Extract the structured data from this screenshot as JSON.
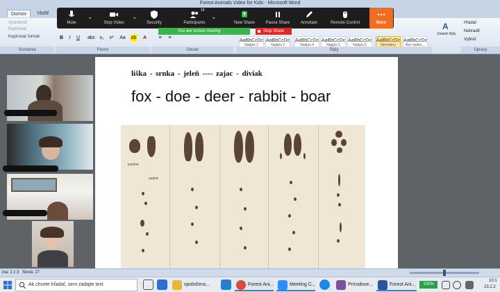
{
  "word": {
    "title": "Forest Animals Video for Kids - Microsoft Word",
    "tabs": [
      {
        "label": "Domov",
        "active": true
      },
      {
        "label": "Vložiť",
        "active": false
      }
    ],
    "clipboard": {
      "paste": "Vystrihnúť",
      "copy": "Kopírovať",
      "format_painter": "Kopírovať formát",
      "group": "Schránka"
    },
    "group_font": "Písmo",
    "group_paragraph": "Odsek",
    "group_styles": "Štýly",
    "group_edit": "Úpravy",
    "styles": [
      {
        "preview": "AaBbCcDc",
        "name": "Nadpis 1"
      },
      {
        "preview": "AaBbCcDc",
        "name": "Nadpis 2"
      },
      {
        "preview": "AaBbCcDc",
        "name": "Nadpis 4"
      },
      {
        "preview": "AaBbCcDc",
        "name": "Nadpis 5"
      },
      {
        "preview": "AaBbCcDc",
        "name": "Nadpis 6"
      },
      {
        "preview": "AaBbCcDc",
        "name": "Normálny"
      },
      {
        "preview": "AaBbCcDc",
        "name": "Bez riadko..."
      }
    ],
    "change_styles": "Zmeniť štýly",
    "find": "Hľadať",
    "replace": "Nahradiť",
    "select": "Vybrať",
    "status_page": "ina: 2 z 3",
    "status_words": "Slová: 27"
  },
  "zoom": {
    "toolbar": [
      {
        "label": "Mute",
        "icon": "mic-icon"
      },
      {
        "label": "Stop Video",
        "icon": "video-camera-icon"
      },
      {
        "label": "Security",
        "icon": "shield-icon"
      },
      {
        "label": "Participants",
        "icon": "participants-icon",
        "count": "10"
      },
      {
        "label": "New Share",
        "icon": "share-arrow-icon"
      },
      {
        "label": "Pause Share",
        "icon": "pause-icon"
      },
      {
        "label": "Annotate",
        "icon": "pen-icon"
      },
      {
        "label": "Remote Control",
        "icon": "mouse-icon"
      },
      {
        "label": "More",
        "icon": "more-dots-icon"
      }
    ],
    "sharing_banner": "You are screen sharing",
    "stop_share": "Stop Share"
  },
  "document": {
    "sk_words": "liška   -   srnka   -   jeleň ----   zajac -   diviak",
    "en_words": "fox  - doe  - deer - rabbit - boar",
    "track_labels": {
      "front": "predné",
      "back": "zadné"
    }
  },
  "taskbar": {
    "search_placeholder": "Ak chcete hľadať, sem zadajte text",
    "apps": [
      {
        "label": "spoločens...",
        "icon": "folder-icon",
        "color": "#e8b73a"
      },
      {
        "label": "Forest Ani...",
        "icon": "chrome-icon",
        "color": "#d84a3a"
      },
      {
        "label": "Meeting C...",
        "icon": "zoom-icon",
        "color": "#2d8cff"
      },
      {
        "label": "Prírodove...",
        "icon": "document-icon",
        "color": "#7a4fa0"
      },
      {
        "label": "Forest Ani...",
        "icon": "word-icon",
        "color": "#2b5797"
      }
    ],
    "battery": "100%",
    "time": "10:1",
    "date": "23.2.2"
  },
  "colors": {
    "zoom_bar": "#1d1d1d",
    "share_green": "#3bb54a",
    "stop_red": "#e02828",
    "more_orange": "#f26d21",
    "paper": "#efe6d6",
    "track": "#5a4535"
  }
}
